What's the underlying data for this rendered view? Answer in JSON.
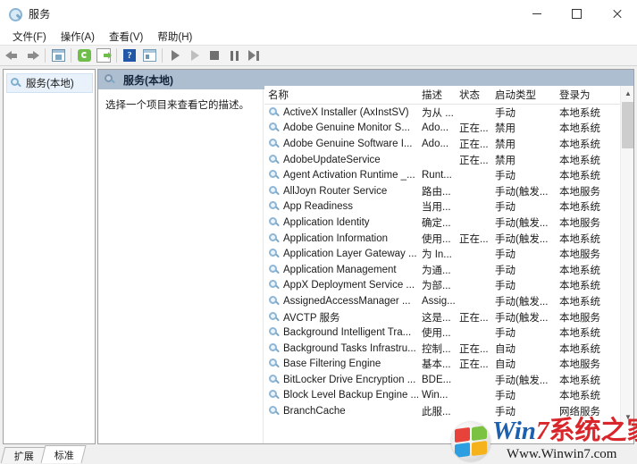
{
  "window": {
    "title": "服务",
    "title_icon": "services-gear-icon",
    "minimize_label": "最小化",
    "maximize_label": "最大化",
    "close_label": "关闭"
  },
  "menubar": {
    "items": [
      {
        "label": "文件(F)",
        "name": "menu-file"
      },
      {
        "label": "操作(A)",
        "name": "menu-action"
      },
      {
        "label": "查看(V)",
        "name": "menu-view"
      },
      {
        "label": "帮助(H)",
        "name": "menu-help"
      }
    ]
  },
  "toolbar": {
    "buttons": [
      {
        "name": "back-arrow-icon",
        "tip": "后退"
      },
      {
        "name": "forward-arrow-icon",
        "tip": "前进"
      },
      {
        "name": "show-hide-tree-icon",
        "tip": "显示/隐藏控制台树"
      },
      {
        "name": "refresh-icon",
        "tip": "刷新"
      },
      {
        "name": "export-list-icon",
        "tip": "导出列表"
      },
      {
        "name": "help-icon",
        "tip": "帮助"
      },
      {
        "name": "properties-icon",
        "tip": "属性"
      },
      {
        "name": "start-service-icon",
        "tip": "启动服务"
      },
      {
        "name": "restart-service-icon",
        "tip": "重启动服务"
      },
      {
        "name": "stop-service-icon",
        "tip": "停止服务"
      },
      {
        "name": "pause-service-icon",
        "tip": "暂停服务"
      },
      {
        "name": "resume-service-icon",
        "tip": "恢复服务"
      }
    ]
  },
  "tree": {
    "root_label": "服务(本地)",
    "root_icon": "services-gear-icon"
  },
  "pane": {
    "header_label": "服务(本地)",
    "header_icon": "services-gear-icon",
    "description_placeholder": "选择一个项目来查看它的描述。"
  },
  "list": {
    "columns": [
      {
        "key": "name",
        "label": "名称"
      },
      {
        "key": "desc",
        "label": "描述"
      },
      {
        "key": "status",
        "label": "状态"
      },
      {
        "key": "start",
        "label": "启动类型"
      },
      {
        "key": "logon",
        "label": "登录为"
      }
    ],
    "rows": [
      {
        "name": "ActiveX Installer (AxInstSV)",
        "desc": "为从 ...",
        "status": "",
        "start": "手动",
        "logon": "本地系统"
      },
      {
        "name": "Adobe Genuine Monitor S...",
        "desc": "Ado...",
        "status": "正在...",
        "start": "禁用",
        "logon": "本地系统"
      },
      {
        "name": "Adobe Genuine Software I...",
        "desc": "Ado...",
        "status": "正在...",
        "start": "禁用",
        "logon": "本地系统"
      },
      {
        "name": "AdobeUpdateService",
        "desc": "",
        "status": "正在...",
        "start": "禁用",
        "logon": "本地系统"
      },
      {
        "name": "Agent Activation Runtime _...",
        "desc": "Runt...",
        "status": "",
        "start": "手动",
        "logon": "本地系统"
      },
      {
        "name": "AllJoyn Router Service",
        "desc": "路由...",
        "status": "",
        "start": "手动(触发...",
        "logon": "本地服务"
      },
      {
        "name": "App Readiness",
        "desc": "当用...",
        "status": "",
        "start": "手动",
        "logon": "本地系统"
      },
      {
        "name": "Application Identity",
        "desc": "确定...",
        "status": "",
        "start": "手动(触发...",
        "logon": "本地服务"
      },
      {
        "name": "Application Information",
        "desc": "使用...",
        "status": "正在...",
        "start": "手动(触发...",
        "logon": "本地系统"
      },
      {
        "name": "Application Layer Gateway ...",
        "desc": "为 In...",
        "status": "",
        "start": "手动",
        "logon": "本地服务"
      },
      {
        "name": "Application Management",
        "desc": "为通...",
        "status": "",
        "start": "手动",
        "logon": "本地系统"
      },
      {
        "name": "AppX Deployment Service ...",
        "desc": "为部...",
        "status": "",
        "start": "手动",
        "logon": "本地系统"
      },
      {
        "name": "AssignedAccessManager ...",
        "desc": "Assig...",
        "status": "",
        "start": "手动(触发...",
        "logon": "本地系统"
      },
      {
        "name": "AVCTP 服务",
        "desc": "这是...",
        "status": "正在...",
        "start": "手动(触发...",
        "logon": "本地服务"
      },
      {
        "name": "Background Intelligent Tra...",
        "desc": "使用...",
        "status": "",
        "start": "手动",
        "logon": "本地系统"
      },
      {
        "name": "Background Tasks Infrastru...",
        "desc": "控制...",
        "status": "正在...",
        "start": "自动",
        "logon": "本地系统"
      },
      {
        "name": "Base Filtering Engine",
        "desc": "基本...",
        "status": "正在...",
        "start": "自动",
        "logon": "本地服务"
      },
      {
        "name": "BitLocker Drive Encryption ...",
        "desc": "BDE...",
        "status": "",
        "start": "手动(触发...",
        "logon": "本地系统"
      },
      {
        "name": "Block Level Backup Engine ...",
        "desc": "Win...",
        "status": "",
        "start": "手动",
        "logon": "本地系统"
      },
      {
        "name": "BranchCache",
        "desc": "此服...",
        "status": "",
        "start": "手动",
        "logon": "网络服务"
      }
    ],
    "row_icon": "service-item-icon",
    "scroll_up_glyph": "▲",
    "scroll_down_glyph": "▼"
  },
  "tabs": [
    {
      "label": "扩展",
      "name": "tab-extended",
      "active": false
    },
    {
      "label": "标准",
      "name": "tab-standard",
      "active": true
    }
  ],
  "watermark": {
    "brand_win": "Win",
    "brand_seven": "7",
    "brand_cn": "系统之家",
    "url": "Www.Winwin7.com"
  },
  "colors": {
    "pane_header": "#aebed1",
    "tree_selection": "#e9f2fb",
    "toolbar_bg": "#f3f3f3",
    "brand_red": "#d8262a",
    "brand_blue": "#1e5fae"
  }
}
